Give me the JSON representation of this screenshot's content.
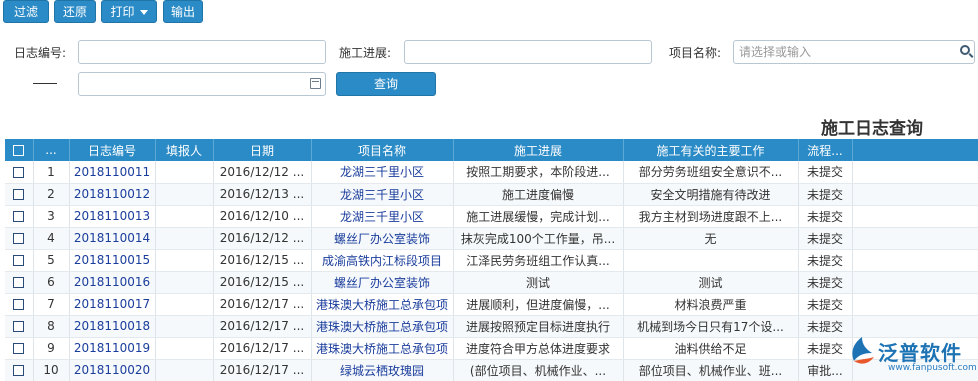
{
  "toolbar": {
    "filter_label": "过滤",
    "reset_label": "还原",
    "print_label": "打印",
    "export_label": "输出"
  },
  "filters": {
    "log_no_label": "日志编号:",
    "progress_label": "施工进展:",
    "project_label": "项目名称:",
    "project_placeholder": "请选择或输入",
    "range_dash": "——",
    "query_label": "查询"
  },
  "page_title": "施工日志查询",
  "table": {
    "columns": [
      "",
      "...",
      "日志编号",
      "填报人",
      "日期",
      "项目名称",
      "施工进展",
      "施工有关的主要工作",
      "流程..."
    ],
    "rows": [
      {
        "n": "1",
        "id": "2018110011",
        "reporter": "",
        "date": "2016/12/12 ...",
        "project": "龙湖三千里小区",
        "progress": "按照工期要求，本阶段进...",
        "work": "部分劳务班组安全意识不...",
        "status": "未提交"
      },
      {
        "n": "2",
        "id": "2018110012",
        "reporter": "",
        "date": "2016/12/13 ...",
        "project": "龙湖三千里小区",
        "progress": "施工进度偏慢",
        "work": "安全文明措施有待改进",
        "status": "未提交"
      },
      {
        "n": "3",
        "id": "2018110013",
        "reporter": "",
        "date": "2016/12/10 ...",
        "project": "龙湖三千里小区",
        "progress": "施工进展缓慢，完成计划...",
        "work": "我方主材到场进度跟不上...",
        "status": "未提交"
      },
      {
        "n": "4",
        "id": "2018110014",
        "reporter": "",
        "date": "2016/12/12 ...",
        "project": "螺丝厂办公室装饰",
        "progress": "抹灰完成100个工作量，吊...",
        "work": "无",
        "status": "未提交"
      },
      {
        "n": "5",
        "id": "2018110015",
        "reporter": "",
        "date": "2016/12/15 ...",
        "project": "成渝高铁内江标段项目",
        "progress": "江泽民劳务班组工作认真...",
        "work": "",
        "status": "未提交"
      },
      {
        "n": "6",
        "id": "2018110016",
        "reporter": "",
        "date": "2016/12/15 ...",
        "project": "螺丝厂办公室装饰",
        "progress": "测试",
        "work": "测试",
        "status": "未提交"
      },
      {
        "n": "7",
        "id": "2018110017",
        "reporter": "",
        "date": "2016/12/17 ...",
        "project": "港珠澳大桥施工总承包项",
        "progress": "进展顺利，但进度偏慢，...",
        "work": "材料浪费严重",
        "status": "未提交"
      },
      {
        "n": "8",
        "id": "2018110018",
        "reporter": "",
        "date": "2016/12/17 ...",
        "project": "港珠澳大桥施工总承包项",
        "progress": "进展按照预定目标进度执行",
        "work": "机械到场今日只有17个设...",
        "status": "未提交"
      },
      {
        "n": "9",
        "id": "2018110019",
        "reporter": "",
        "date": "2016/12/17 ...",
        "project": "港珠澳大桥施工总承包项",
        "progress": "进度符合甲方总体进度要求",
        "work": "油料供给不足",
        "status": "未提交"
      },
      {
        "n": "10",
        "id": "2018110020",
        "reporter": "",
        "date": "2016/12/17 ...",
        "project": "绿城云栖玫瑰园",
        "progress": "(部位项目、机械作业、...",
        "work": "部位项目、机械作业、班...",
        "status": "审批..."
      }
    ]
  },
  "logo": {
    "name": "泛普软件",
    "url": "www.fanpusoft.com",
    "brand_color": "#1e73b4"
  }
}
